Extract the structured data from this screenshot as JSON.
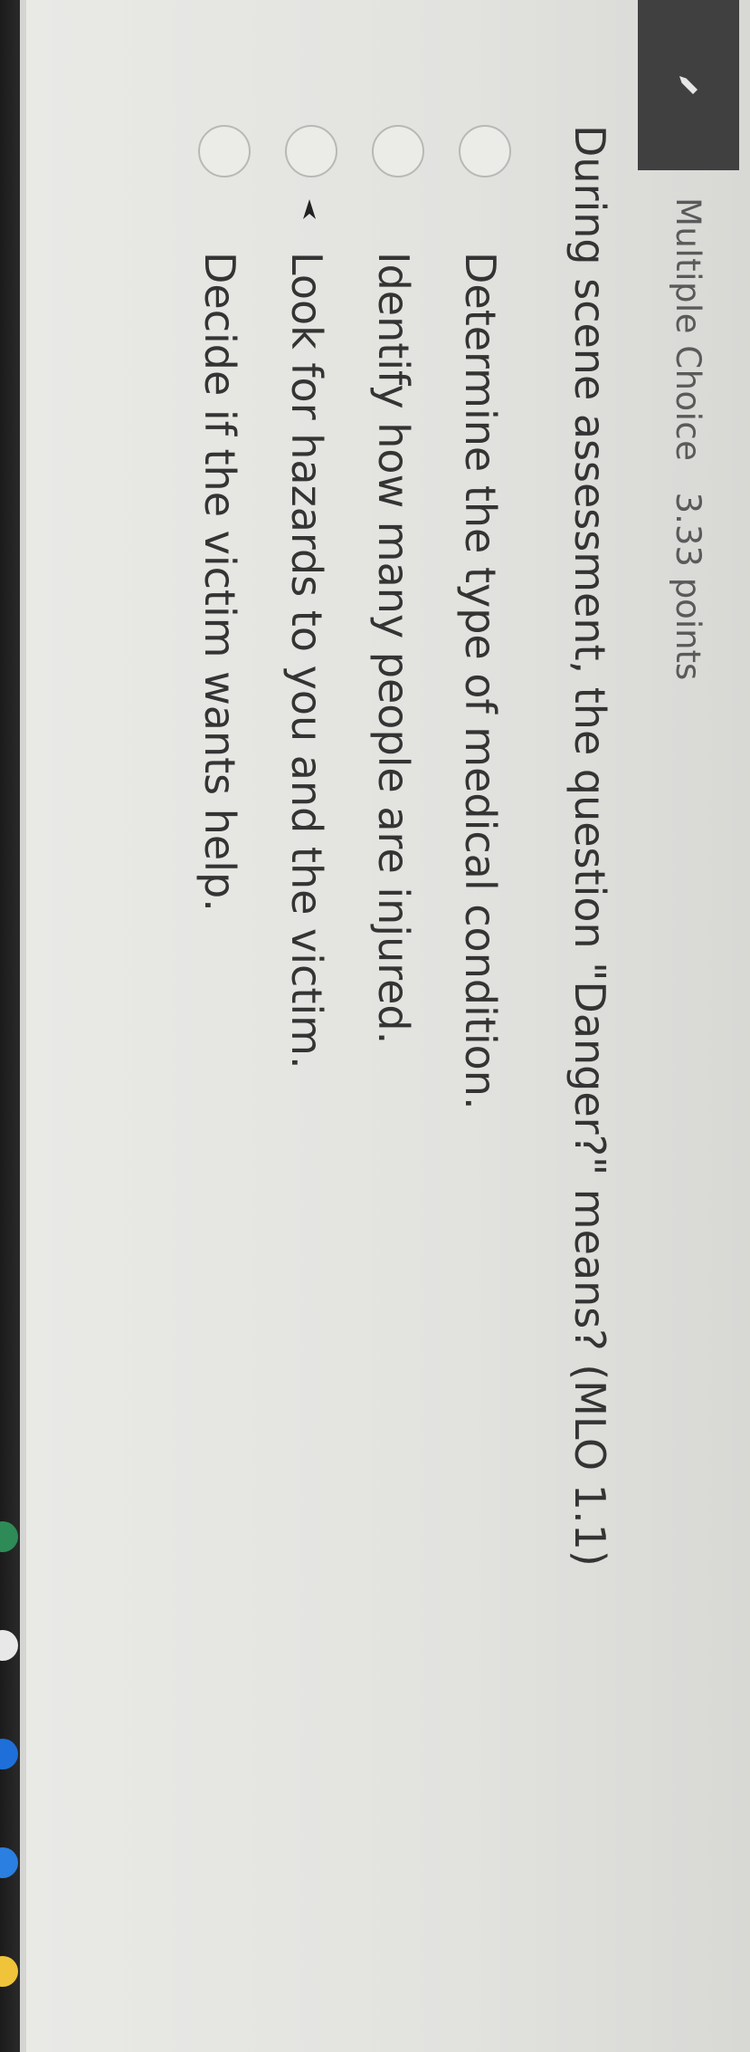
{
  "question_header": {
    "type_label": "Multiple Choice",
    "points": "3.33 points",
    "badge_icon": "pencil-icon"
  },
  "question": {
    "text": "During scene assessment, the question \"Danger?\" means? (MLO 1.1)"
  },
  "options": [
    {
      "label": "Determine the type of medical condition."
    },
    {
      "label": "Identify how many people are injured."
    },
    {
      "label": "Look for hazards to you and the victim."
    },
    {
      "label": "Decide if the victim wants help."
    }
  ],
  "colors": {
    "badge": "#3f403f",
    "text": "#343434",
    "muted": "#5a5a5a"
  }
}
